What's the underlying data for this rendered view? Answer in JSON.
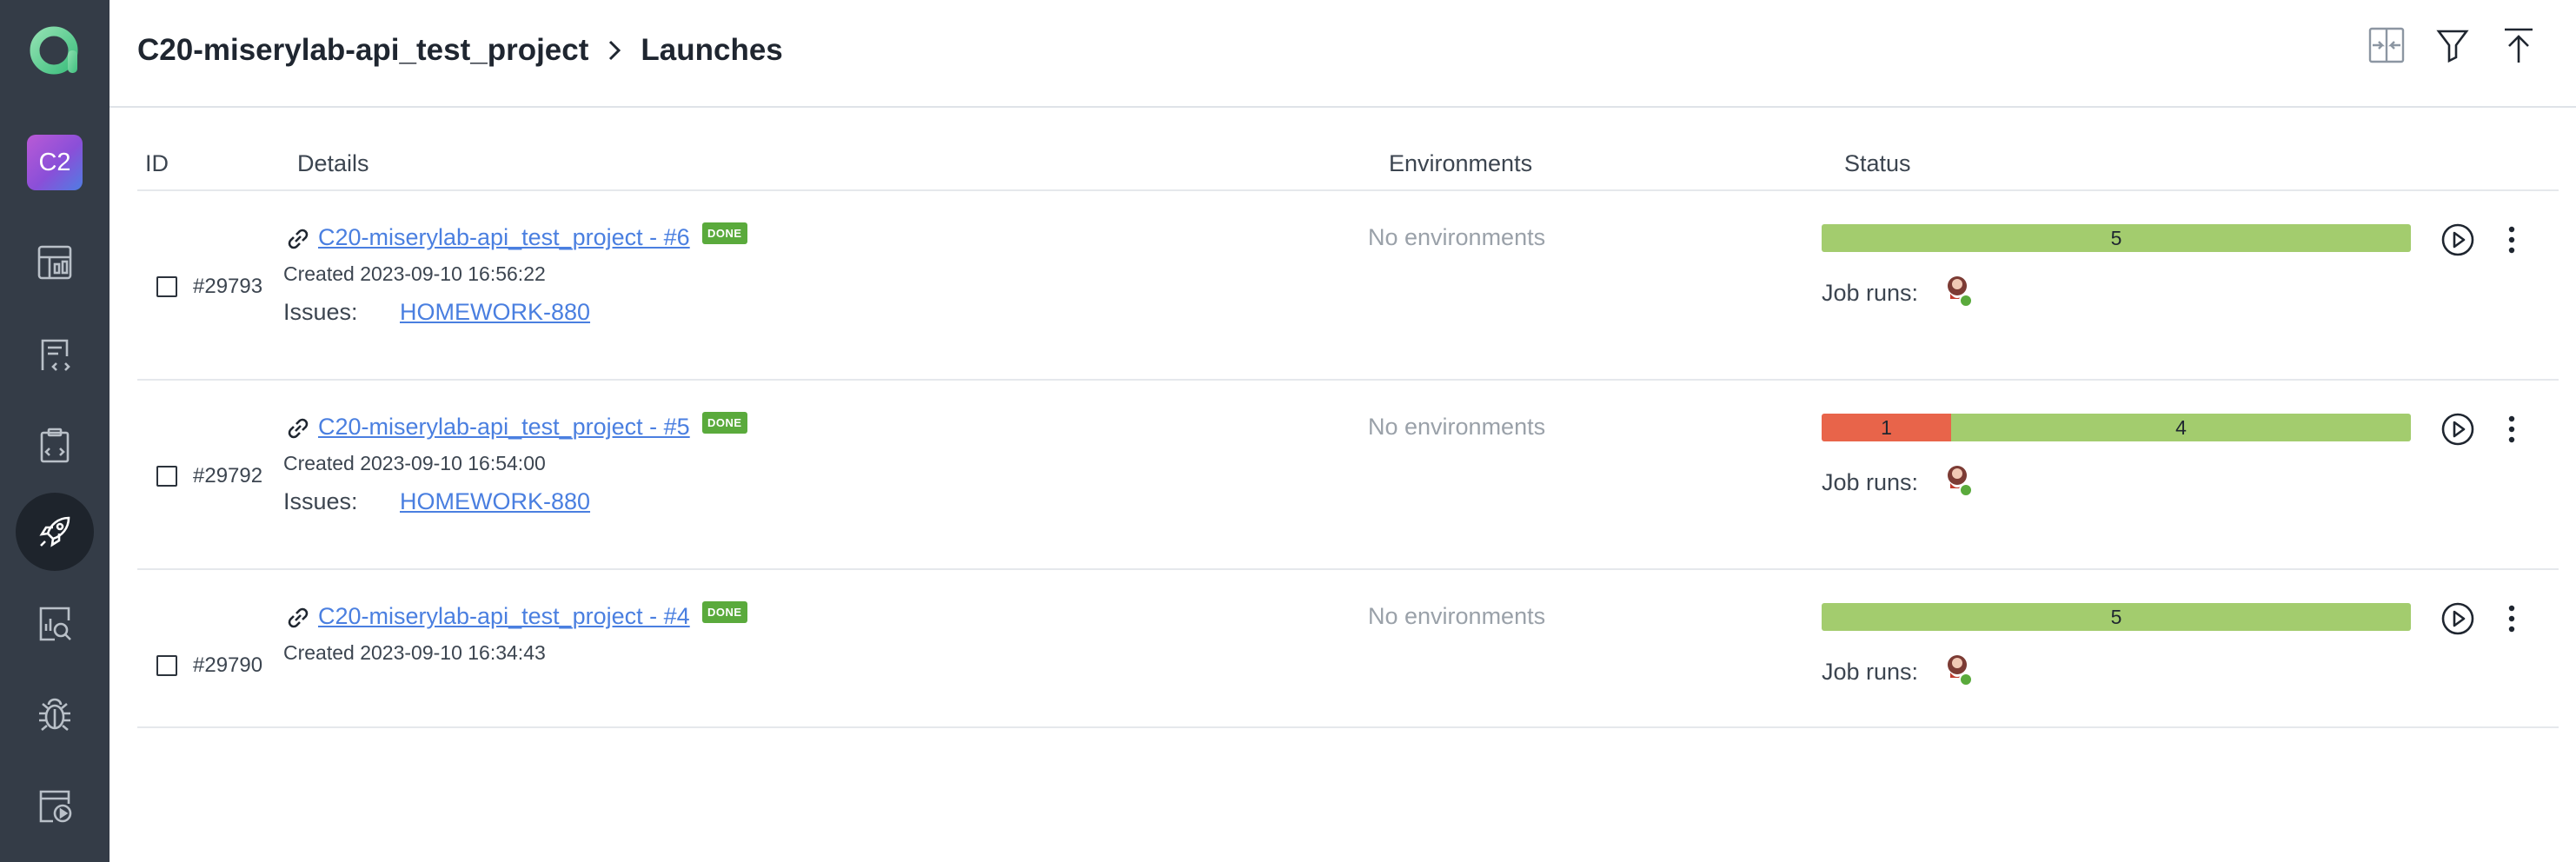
{
  "project_badge": "C2",
  "breadcrumb": {
    "project": "C20-miserylab-api_test_project",
    "page": "Launches"
  },
  "columns": {
    "id": "ID",
    "details": "Details",
    "environments": "Environments",
    "status": "Status"
  },
  "labels": {
    "issues": "Issues:",
    "job_runs": "Job runs:"
  },
  "colors": {
    "pass": "#a3cc6e",
    "fail": "#e8644a",
    "link": "#4a7fe0",
    "done_badge": "#5aaa3c",
    "sidebar": "#343c47"
  },
  "icons": {
    "sidebar": [
      "logo-icon",
      "dashboards-icon",
      "test-cases-icon",
      "test-plans-icon",
      "launches-icon",
      "analytics-icon",
      "defects-icon",
      "jobs-icon"
    ],
    "header": [
      "compare-icon",
      "filter-icon",
      "export-icon"
    ]
  },
  "launches": [
    {
      "id": "#29793",
      "title": "C20-miserylab-api_test_project - #6",
      "badge": "DONE",
      "created": "Created 2023-09-10 16:56:22",
      "issue": "HOMEWORK-880",
      "environment": "No environments",
      "results": {
        "failed": 0,
        "passed": 5
      }
    },
    {
      "id": "#29792",
      "title": "C20-miserylab-api_test_project - #5",
      "badge": "DONE",
      "created": "Created 2023-09-10 16:54:00",
      "issue": "HOMEWORK-880",
      "environment": "No environments",
      "results": {
        "failed": 1,
        "passed": 4
      }
    },
    {
      "id": "#29790",
      "title": "C20-miserylab-api_test_project - #4",
      "badge": "DONE",
      "created": "Created 2023-09-10 16:34:43",
      "issue": "",
      "environment": "No environments",
      "results": {
        "failed": 0,
        "passed": 5
      }
    }
  ]
}
